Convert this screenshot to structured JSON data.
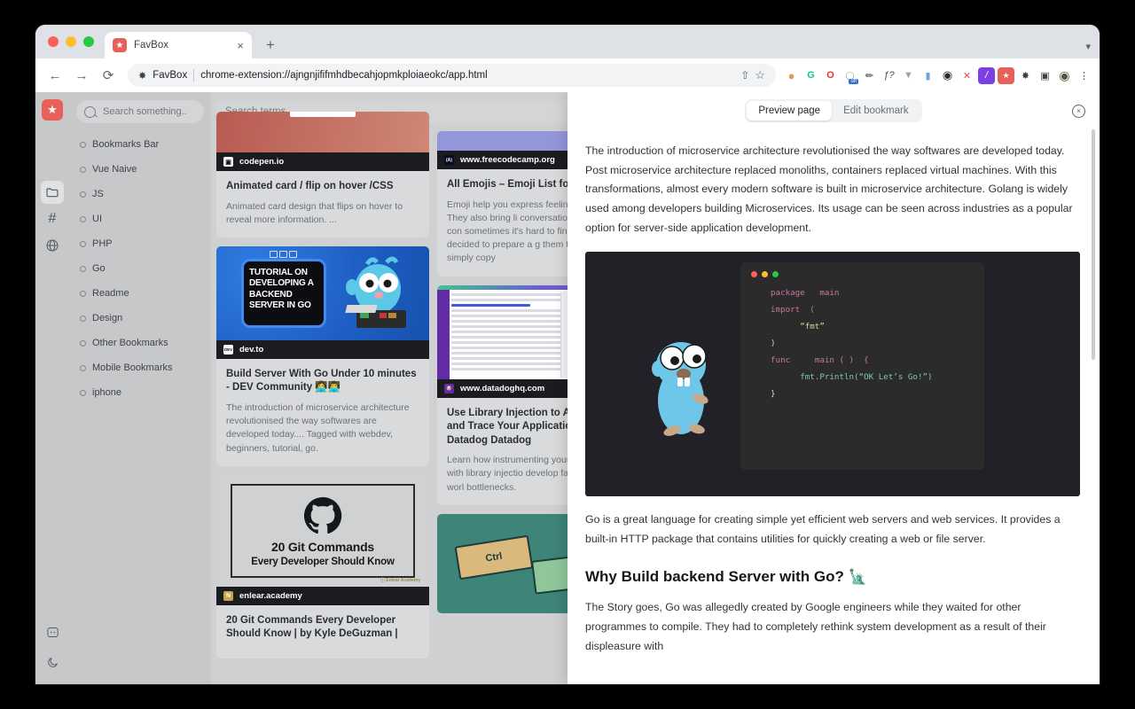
{
  "browser": {
    "tab": {
      "title": "FavBox",
      "favicon": "star-icon",
      "close_label": "×"
    },
    "new_tab_label": "+",
    "nav": {
      "back": "←",
      "forward": "→",
      "reload": "⟳"
    },
    "omnibox": {
      "extension_icon": "puzzle-icon",
      "extension_name": "FavBox",
      "url": "chrome-extension://ajngnjififmhdbecahjopmkploiaeokc/app.html",
      "share_icon": "⇧",
      "bookmark_icon": "☆"
    },
    "extensions": [
      {
        "name": "cookie-extension-icon",
        "glyph": "●",
        "color": "#d89b52",
        "bg": "transparent"
      },
      {
        "name": "grammarly-extension-icon",
        "glyph": "G",
        "color": "#15c39a",
        "bg": "transparent"
      },
      {
        "name": "opera-extension-icon",
        "glyph": "O",
        "color": "#e8302f",
        "bg": "transparent"
      },
      {
        "name": "adblock-off-extension-icon",
        "glyph": "off",
        "color": "#2f6fd0",
        "bg": "transparent"
      },
      {
        "name": "colorpicker-extension-icon",
        "glyph": "✒",
        "color": "#3b3b3b",
        "bg": "transparent"
      },
      {
        "name": "font-inspector-extension-icon",
        "glyph": "ƒ?",
        "color": "#4a4a4a",
        "bg": "transparent"
      },
      {
        "name": "vue-devtools-extension-icon",
        "glyph": "▼",
        "color": "#9aa3ad",
        "bg": "transparent"
      },
      {
        "name": "clipboard-extension-icon",
        "glyph": "▐",
        "color": "#6fa8dc",
        "bg": "transparent"
      },
      {
        "name": "camera-extension-icon",
        "glyph": "◉",
        "color": "#2b2b2b",
        "bg": "transparent"
      },
      {
        "name": "scissors-extension-icon",
        "glyph": "✂",
        "color": "#e8485f",
        "bg": "transparent"
      },
      {
        "name": "slash-extension-icon",
        "glyph": "/",
        "color": "#ffffff",
        "bg": "#7b3fe4"
      },
      {
        "name": "favbox-extension-icon",
        "glyph": "★",
        "color": "#ffffff",
        "bg": "#e8605a"
      },
      {
        "name": "puzzle-extensions-icon",
        "glyph": "❈",
        "color": "#3c4043",
        "bg": "transparent"
      },
      {
        "name": "sidepanel-icon",
        "glyph": "▣",
        "color": "#3c4043",
        "bg": "transparent"
      },
      {
        "name": "profile-avatar-icon",
        "glyph": "●",
        "color": "#4a5a3a",
        "bg": "transparent"
      },
      {
        "name": "chrome-menu-icon",
        "glyph": "⋮",
        "color": "#3c4043",
        "bg": "transparent"
      }
    ]
  },
  "rail": {
    "logo": "★",
    "buttons": [
      {
        "name": "folder-icon",
        "glyph": "folder",
        "active": true
      },
      {
        "name": "hash-icon",
        "glyph": "#",
        "active": false
      },
      {
        "name": "globe-icon",
        "glyph": "globe",
        "active": false
      }
    ],
    "bottom": [
      {
        "name": "github-icon",
        "glyph": "github"
      },
      {
        "name": "dark-mode-moon-icon",
        "glyph": "moon"
      }
    ]
  },
  "sidebar": {
    "search_placeholder": "Search something..",
    "folders": [
      {
        "label": "Bookmarks Bar"
      },
      {
        "label": "Vue Naive"
      },
      {
        "label": "JS"
      },
      {
        "label": "UI"
      },
      {
        "label": "PHP"
      },
      {
        "label": "Go"
      },
      {
        "label": "Readme"
      },
      {
        "label": "Design"
      },
      {
        "label": "Other Bookmarks"
      },
      {
        "label": "Mobile Bookmarks"
      },
      {
        "label": "iphone"
      }
    ]
  },
  "cards_area": {
    "terms_placeholder": "Search terms...",
    "column_left": [
      {
        "thumb": "codepen-thumb",
        "domain": "codepen.io",
        "favicon_glyph": "▣",
        "favicon_bg": "#ffffff",
        "favicon_color": "#111111",
        "title": "Animated card / flip on hover /CSS",
        "desc": "Animated card design that flips on hover to reveal more information. ..."
      },
      {
        "thumb": "go-tutorial-thumb",
        "thumb_text": "TUTORIAL ON DEVELOPING A BACKEND SERVER IN GO",
        "domain": "dev.to",
        "favicon_glyph": "DEV",
        "favicon_bg": "#ffffff",
        "favicon_color": "#111111",
        "title": "Build Server With Go Under 10 minutes - DEV Community 👩‍💻👨‍💻",
        "desc": "The introduction of microservice architecture revolutionised the way softwares are developed today.... Tagged with webdev, beginners, tutorial, go."
      },
      {
        "thumb": "github-commands-thumb",
        "thumb_title": "20 Git Commands",
        "thumb_subtitle": "Every Developer Should Know",
        "thumb_credit": "ⓘ Enlear Academy",
        "domain": "enlear.academy",
        "favicon_glyph": "N",
        "favicon_bg": "#c8a449",
        "favicon_color": "#ffffff",
        "title": "20 Git Commands Every Developer Should Know | by Kyle DeGuzman |",
        "desc": ""
      }
    ],
    "column_right": [
      {
        "thumb": "freecodecamp-thumb",
        "domain": "www.freecodecamp.org",
        "favicon_glyph": "(A)",
        "favicon_bg": "#0a0a23",
        "favicon_color": "#ffffff",
        "title": "All Emojis – Emoji List for C Paste",
        "desc": "Emoji help you express feelings beyond texts. They also bring li conversations in a fun and con sometimes it's hard to find the use, so I decided to prepare a g them that you can simply copy"
      },
      {
        "thumb": "datadog-screenshot-thumb",
        "domain": "www.datadoghq.com",
        "favicon_glyph": "🐶",
        "favicon_bg": "#632ca6",
        "favicon_color": "#ffffff",
        "title": "Use Library Injection to Au Instrument and Trace Your Applications With Datadog Datadog",
        "desc": "Learn how instrumenting your k application with library injectio develop faster and bypass worl bottlenecks."
      },
      {
        "thumb": "ctrl-keys-thumb",
        "thumb_key1": "Ctrl",
        "thumb_key2": "",
        "domain": "",
        "favicon_glyph": "",
        "favicon_bg": "transparent",
        "favicon_color": "#ffffff",
        "title": "",
        "desc": ""
      }
    ]
  },
  "preview": {
    "tabs": [
      {
        "label": "Preview page",
        "active": true
      },
      {
        "label": "Edit bookmark",
        "active": false
      }
    ],
    "close_label": "×",
    "paragraph1": "The introduction of microservice architecture revolutionised the way softwares are developed today. Post microservice architecture replaced monoliths, containers replaced virtual machines. With this transformations, almost every modern software is built in microservice architecture. Golang is widely used among developers building Microservices. Its usage can be seen across industries as a popular option for server-side application development.",
    "code_lines": [
      {
        "text": "package   main",
        "class": "kw-id"
      },
      {
        "text": "import  (",
        "class": "kw"
      },
      {
        "text": "      “fmt”",
        "class": "str"
      },
      {
        "text": ")",
        "class": "plain"
      },
      {
        "text": "func     main ( )  {",
        "class": "kw-id"
      },
      {
        "text": "      fmt.Println(“OK Let’s Go!”)",
        "class": "fn"
      },
      {
        "text": "}",
        "class": "plain"
      }
    ],
    "paragraph2": "Go is a great language for creating simple yet efficient web servers and web services. It provides a built-in HTTP package that contains utilities for quickly creating a web or file server.",
    "heading": "Why Build backend Server with Go? 🗽",
    "paragraph3": "The Story goes, Go was allegedly created by Google engineers while they waited for other programmes to compile. They had to completely rethink system development as a result of their displeasure with"
  },
  "colors": {
    "accent_red": "#e8605a",
    "chrome_tabbar": "#dee1e6",
    "app_bg": "#cfd0d1",
    "card_bg": "#d9dadb",
    "domain_bar": "#1b1c20",
    "go_blue": "#1f5fc4",
    "code_bg": "#2b2b2b"
  }
}
